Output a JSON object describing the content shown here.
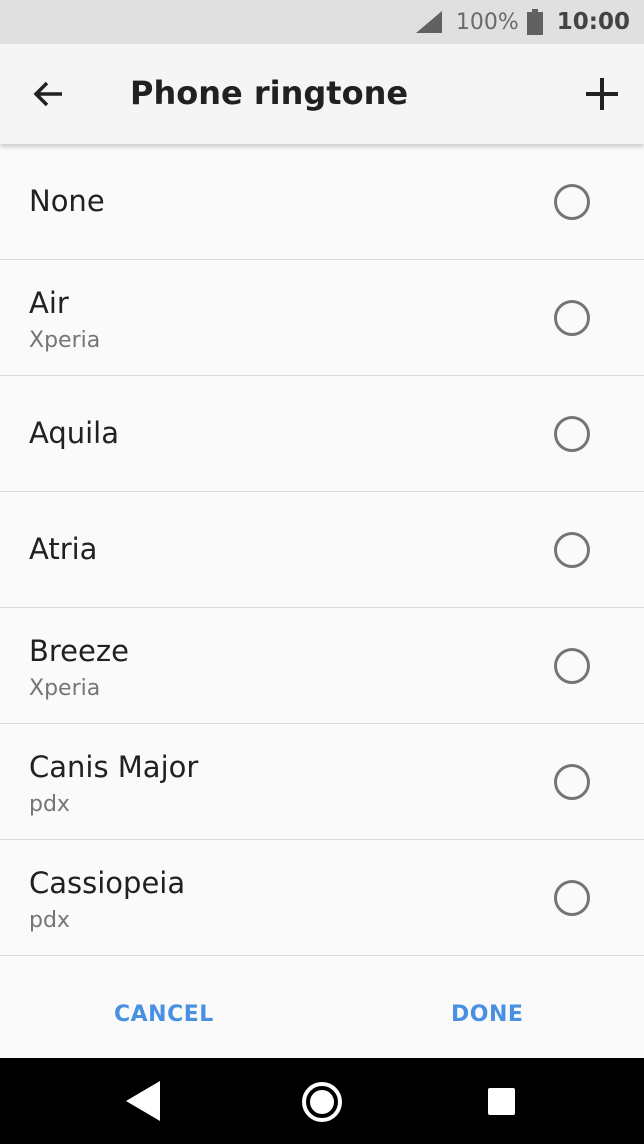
{
  "status_bar": {
    "battery_percent": "100%",
    "time": "10:00",
    "icons": [
      "signal-icon",
      "battery-icon"
    ]
  },
  "app_bar": {
    "title": "Phone ringtone",
    "icons": [
      "back-arrow-icon",
      "add-icon"
    ]
  },
  "ringtones": [
    {
      "name": "None",
      "source": ""
    },
    {
      "name": "Air",
      "source": "Xperia"
    },
    {
      "name": "Aquila",
      "source": ""
    },
    {
      "name": "Atria",
      "source": ""
    },
    {
      "name": "Breeze",
      "source": "Xperia"
    },
    {
      "name": "Canis Major",
      "source": "pdx"
    },
    {
      "name": "Cassiopeia",
      "source": "pdx"
    }
  ],
  "actions": {
    "cancel_label": "CANCEL",
    "done_label": "DONE"
  },
  "colors": {
    "accent": "#4a90e2",
    "status_bar_bg": "#e0e0e0",
    "nav_bar_bg": "#000000"
  },
  "nav_bar": {
    "icons": [
      "nav-back-icon",
      "nav-home-icon",
      "nav-recents-icon"
    ]
  }
}
